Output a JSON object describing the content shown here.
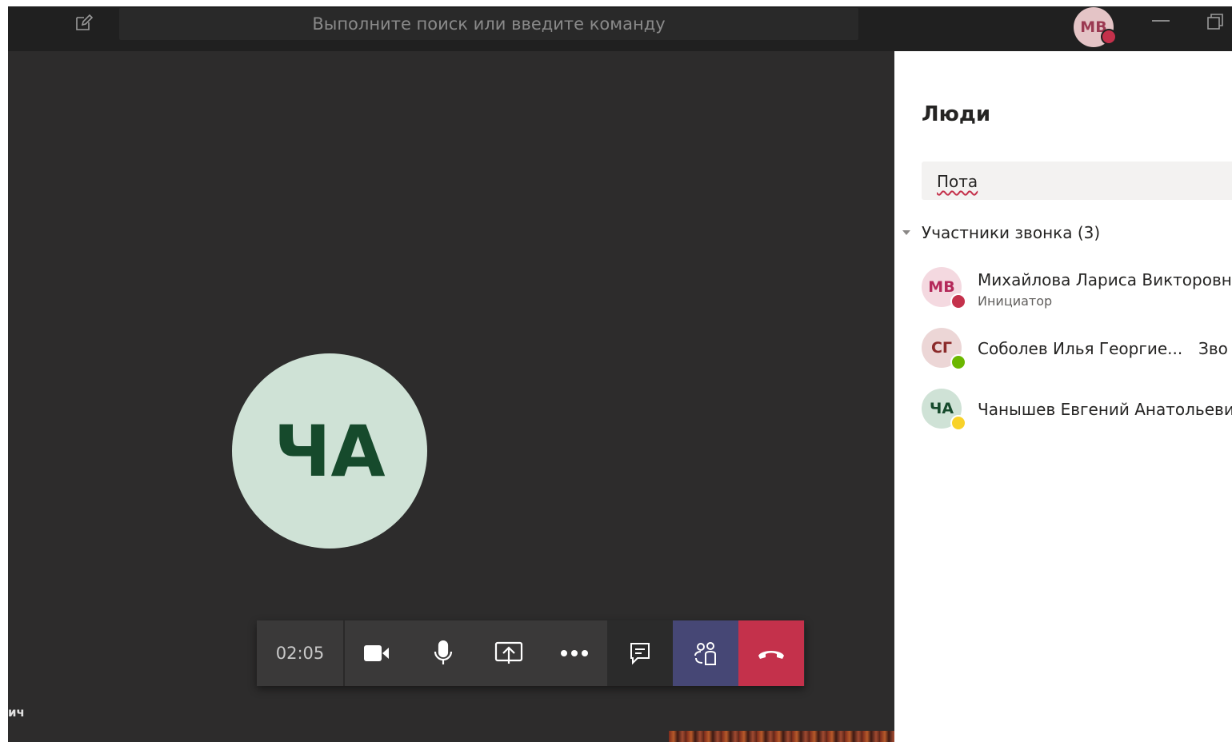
{
  "topbar": {
    "search_placeholder": "Выполните поиск или введите команду",
    "user_initials": "МВ"
  },
  "stage": {
    "main_avatar_initials": "ЧА",
    "participant_label": "ич"
  },
  "controls": {
    "timer": "02:05",
    "buttons": [
      "camera-icon",
      "mic-icon",
      "share-screen-icon",
      "more-options-icon",
      "chat-icon",
      "people-icon",
      "hang-up-icon"
    ]
  },
  "panel": {
    "title": "Люди",
    "search_value": "Пота",
    "section_label": "Участники звонка (3)",
    "people": [
      {
        "initials": "МВ",
        "name": "Михайлова Лариса Викторовна",
        "role": "Инициатор",
        "extra": "",
        "status": "busy",
        "status_color": "#c4314b",
        "avatar_bg": "#f4d9e0",
        "avatar_fg": "#b4295a"
      },
      {
        "initials": "СГ",
        "name": "Соболев Илья Георгие...",
        "role": "",
        "extra": "Зво",
        "status": "available",
        "status_color": "#6bb700",
        "avatar_bg": "#ecd6d6",
        "avatar_fg": "#8b2a2a"
      },
      {
        "initials": "ЧА",
        "name": "Чанышев Евгений Анатольевич",
        "role": "",
        "extra": "",
        "status": "away",
        "status_color": "#f8d22a",
        "avatar_bg": "#cfe2d6",
        "avatar_fg": "#164a2c"
      }
    ]
  },
  "colors": {
    "topbar": "#202020",
    "stage": "#2d2c2c",
    "people_button": "#464775",
    "hangup_button": "#c4314b"
  }
}
